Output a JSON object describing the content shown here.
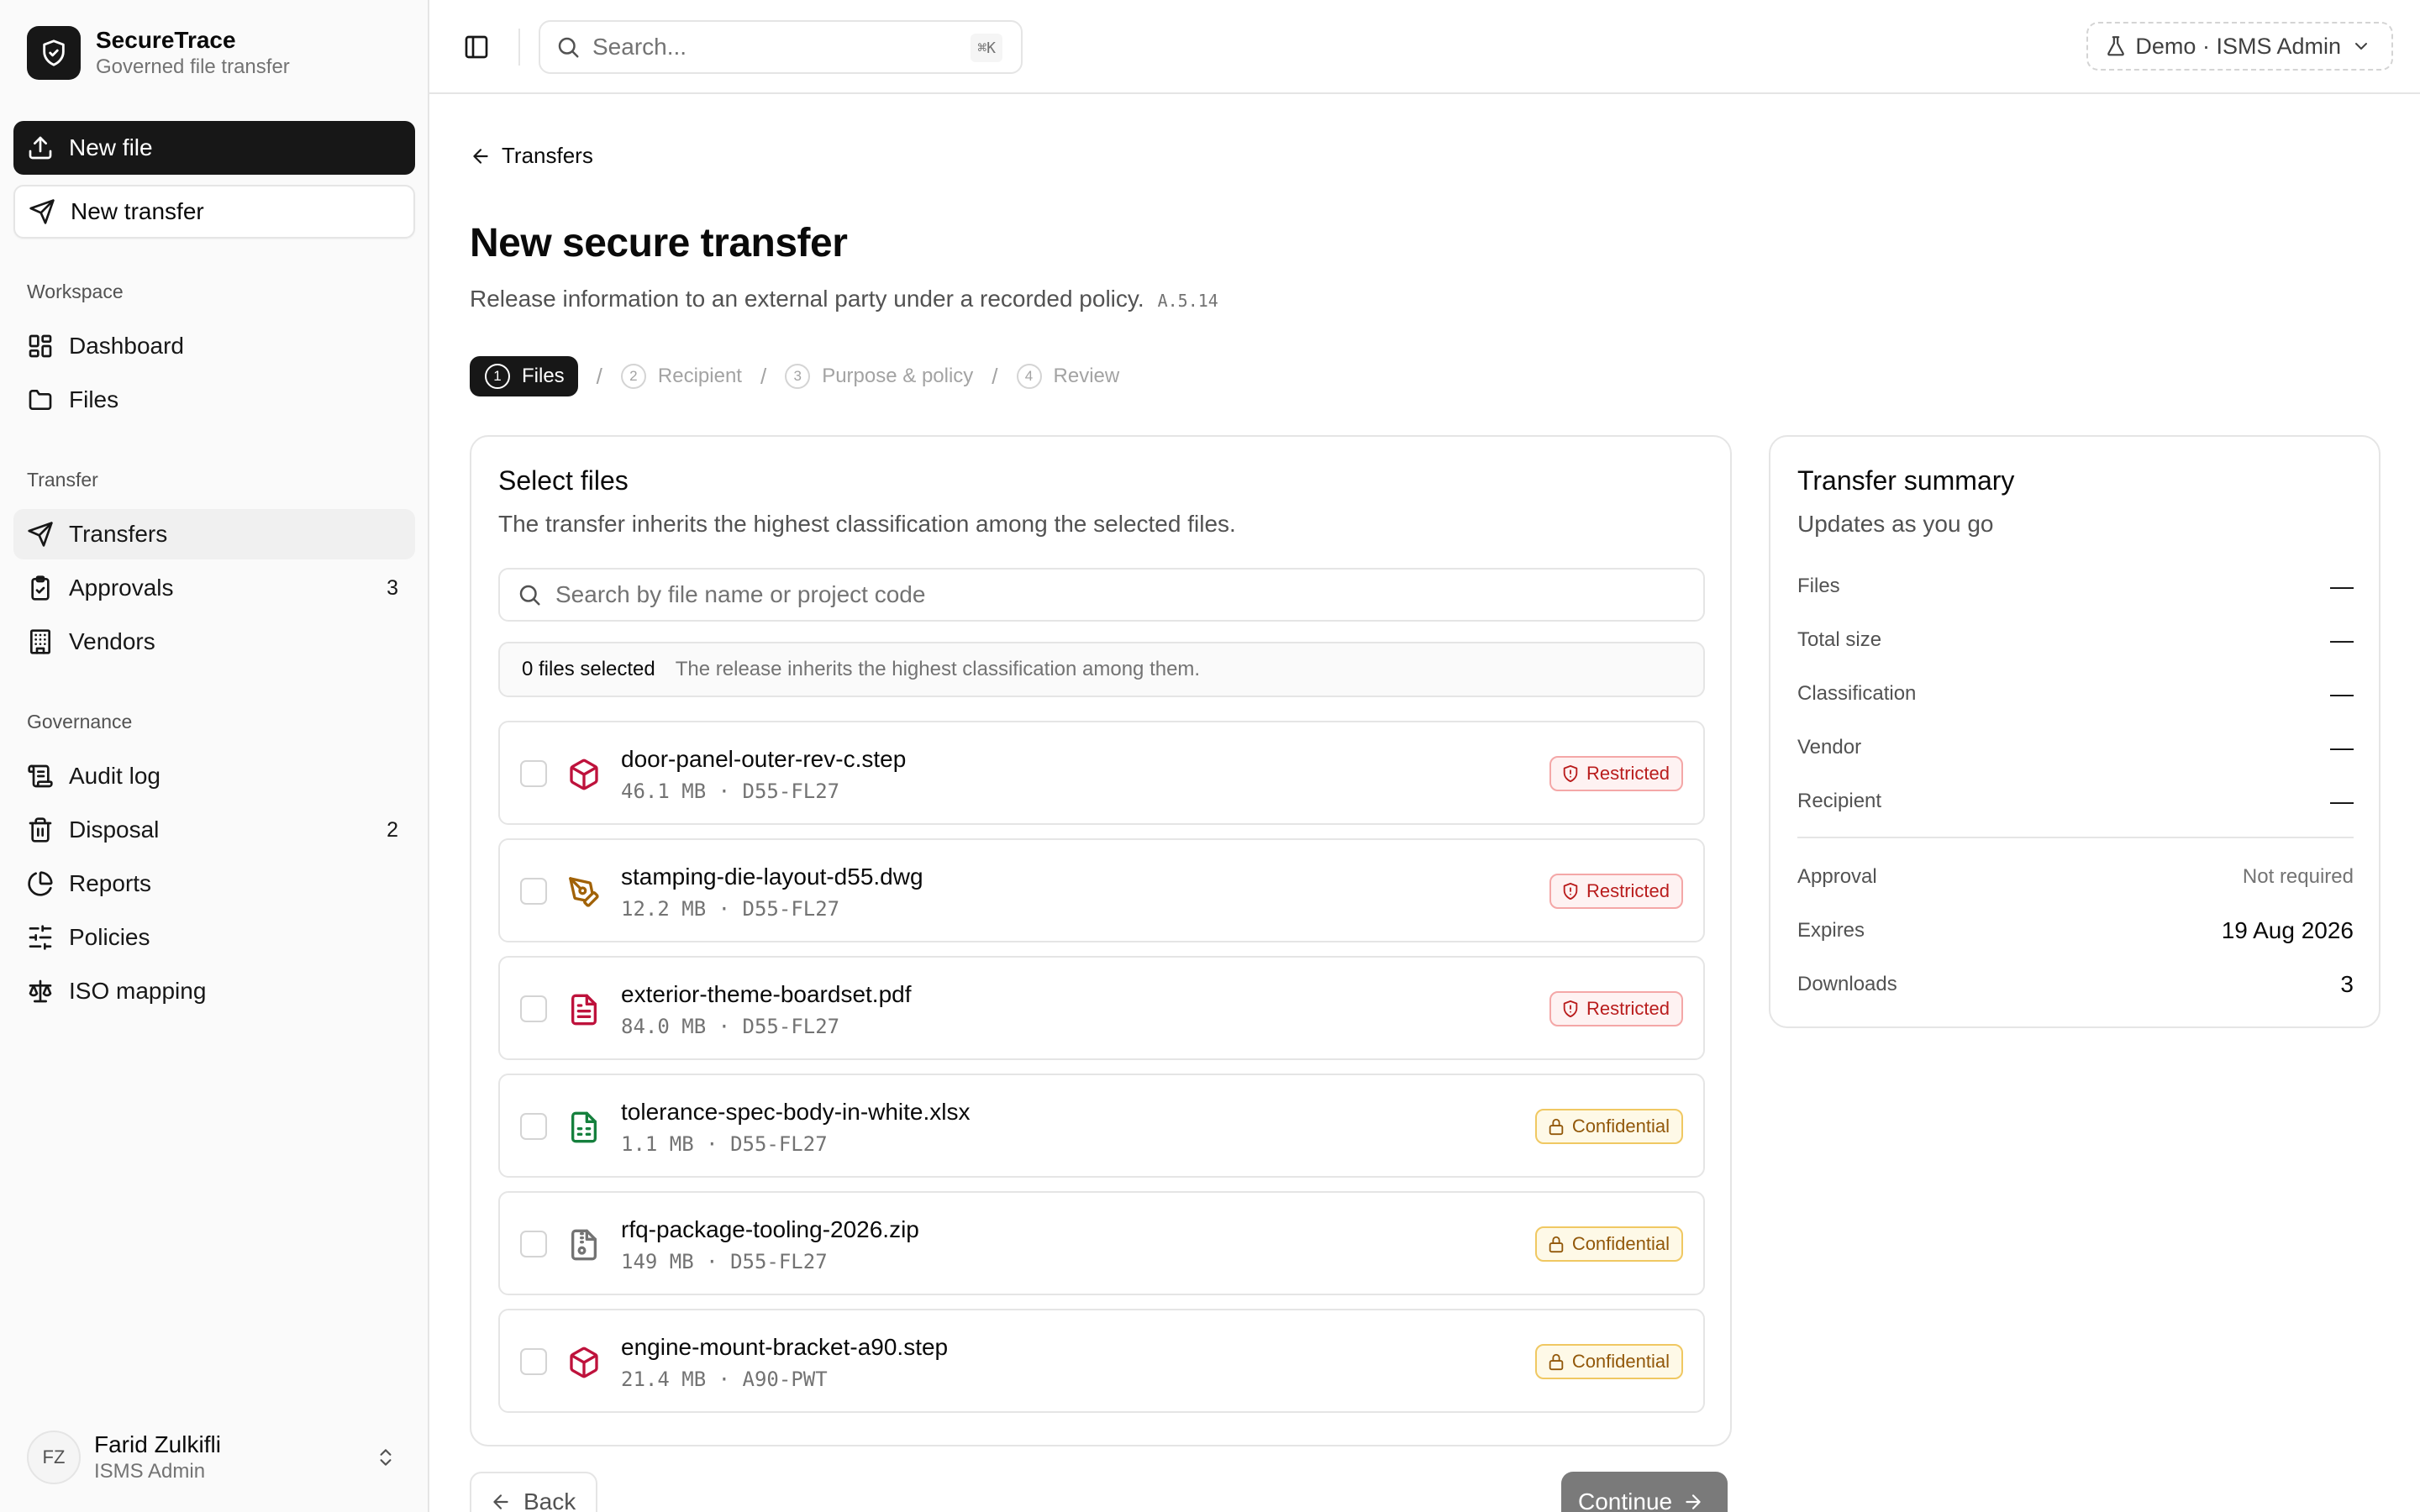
{
  "app": {
    "name": "SecureTrace",
    "tagline": "Governed file transfer"
  },
  "sidebar": {
    "new_file_label": "New file",
    "new_transfer_label": "New transfer",
    "sections": [
      {
        "label": "Workspace",
        "items": [
          {
            "label": "Dashboard",
            "icon": "dashboard-icon"
          },
          {
            "label": "Files",
            "icon": "folder-icon"
          }
        ]
      },
      {
        "label": "Transfer",
        "items": [
          {
            "label": "Transfers",
            "icon": "send-icon",
            "active": true
          },
          {
            "label": "Approvals",
            "icon": "clipboard-check-icon",
            "count": "3"
          },
          {
            "label": "Vendors",
            "icon": "building-icon"
          }
        ]
      },
      {
        "label": "Governance",
        "items": [
          {
            "label": "Audit log",
            "icon": "scroll-icon"
          },
          {
            "label": "Disposal",
            "icon": "trash-icon",
            "count": "2"
          },
          {
            "label": "Reports",
            "icon": "chart-pie-icon"
          },
          {
            "label": "Policies",
            "icon": "sliders-icon"
          },
          {
            "label": "ISO mapping",
            "icon": "scale-icon"
          }
        ]
      }
    ],
    "user": {
      "initials": "FZ",
      "name": "Farid Zulkifli",
      "role": "ISMS Admin"
    }
  },
  "topbar": {
    "search_placeholder": "Search...",
    "search_shortcut": "⌘K",
    "demo_label": "Demo · ISMS Admin"
  },
  "page": {
    "back_label": "Transfers",
    "title": "New secure transfer",
    "subtitle": "Release information to an external party under a recorded policy.",
    "control_code": "A.5.14",
    "steps": [
      {
        "num": "1",
        "label": "Files",
        "active": true
      },
      {
        "num": "2",
        "label": "Recipient"
      },
      {
        "num": "3",
        "label": "Purpose & policy"
      },
      {
        "num": "4",
        "label": "Review"
      }
    ]
  },
  "files_card": {
    "title": "Select files",
    "subtitle": "The transfer inherits the highest classification among the selected files.",
    "search_placeholder": "Search by file name or project code",
    "selected_count": "0 files selected",
    "selected_hint": "The release inherits the highest classification among them.",
    "files": [
      {
        "name": "door-panel-outer-rev-c.step",
        "size": "46.1 MB",
        "project": "D55-FL27",
        "classification": "Restricted",
        "icon": "cube-icon",
        "icon_color": "#be123c"
      },
      {
        "name": "stamping-die-layout-d55.dwg",
        "size": "12.2 MB",
        "project": "D55-FL27",
        "classification": "Restricted",
        "icon": "pen-tool-icon",
        "icon_color": "#a16207"
      },
      {
        "name": "exterior-theme-boardset.pdf",
        "size": "84.0 MB",
        "project": "D55-FL27",
        "classification": "Restricted",
        "icon": "file-text-icon",
        "icon_color": "#be123c"
      },
      {
        "name": "tolerance-spec-body-in-white.xlsx",
        "size": "1.1 MB",
        "project": "D55-FL27",
        "classification": "Confidential",
        "icon": "file-spreadsheet-icon",
        "icon_color": "#15803d"
      },
      {
        "name": "rfq-package-tooling-2026.zip",
        "size": "149 MB",
        "project": "D55-FL27",
        "classification": "Confidential",
        "icon": "file-archive-icon",
        "icon_color": "#737373"
      },
      {
        "name": "engine-mount-bracket-a90.step",
        "size": "21.4 MB",
        "project": "A90-PWT",
        "classification": "Confidential",
        "icon": "cube-icon",
        "icon_color": "#be123c"
      }
    ]
  },
  "summary": {
    "title": "Transfer summary",
    "subtitle": "Updates as you go",
    "rows": [
      {
        "label": "Files",
        "value": "—"
      },
      {
        "label": "Total size",
        "value": "—"
      },
      {
        "label": "Classification",
        "value": "—"
      },
      {
        "label": "Vendor",
        "value": "—"
      },
      {
        "label": "Recipient",
        "value": "—"
      }
    ],
    "rows2": [
      {
        "label": "Approval",
        "value": "Not required"
      },
      {
        "label": "Expires",
        "value": "19 Aug 2026"
      },
      {
        "label": "Downloads",
        "value": "3"
      }
    ]
  },
  "footer": {
    "back_label": "Back",
    "continue_label": "Continue"
  },
  "colors": {
    "primary": "#171717",
    "restricted": "#b91c1c",
    "confidential": "#92580a",
    "continue_disabled": "#7a7a7a"
  }
}
